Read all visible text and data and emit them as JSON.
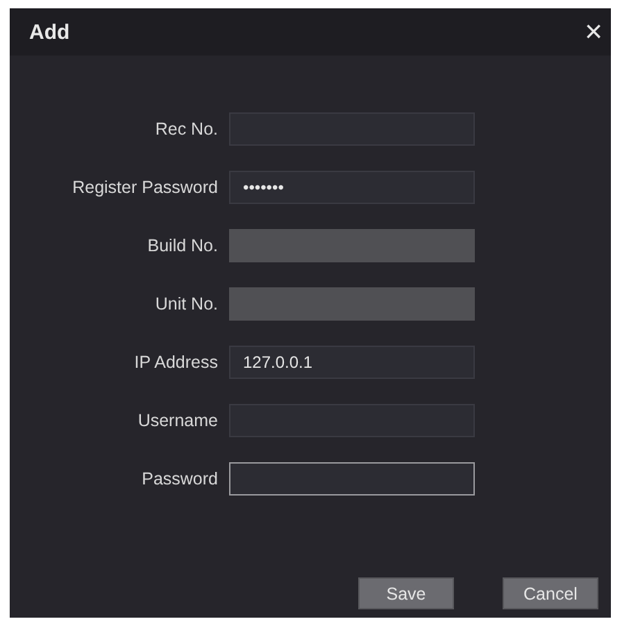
{
  "dialog": {
    "title": "Add",
    "close": "×"
  },
  "fields": [
    {
      "label": "Rec No.",
      "disabled": false,
      "focused": false
    },
    {
      "label": "Register Password",
      "value": "•••••••",
      "disabled": false,
      "focused": false
    },
    {
      "label": "Build No.",
      "disabled": true,
      "focused": false
    },
    {
      "label": "Unit No.",
      "disabled": true,
      "focused": false
    },
    {
      "label": "IP Address",
      "value": "127.0.0.1",
      "disabled": false,
      "focused": false
    },
    {
      "label": "Username",
      "disabled": false,
      "focused": false
    },
    {
      "label": "Password",
      "disabled": false,
      "focused": true
    }
  ],
  "buttons": [
    "Save",
    "Cancel"
  ]
}
